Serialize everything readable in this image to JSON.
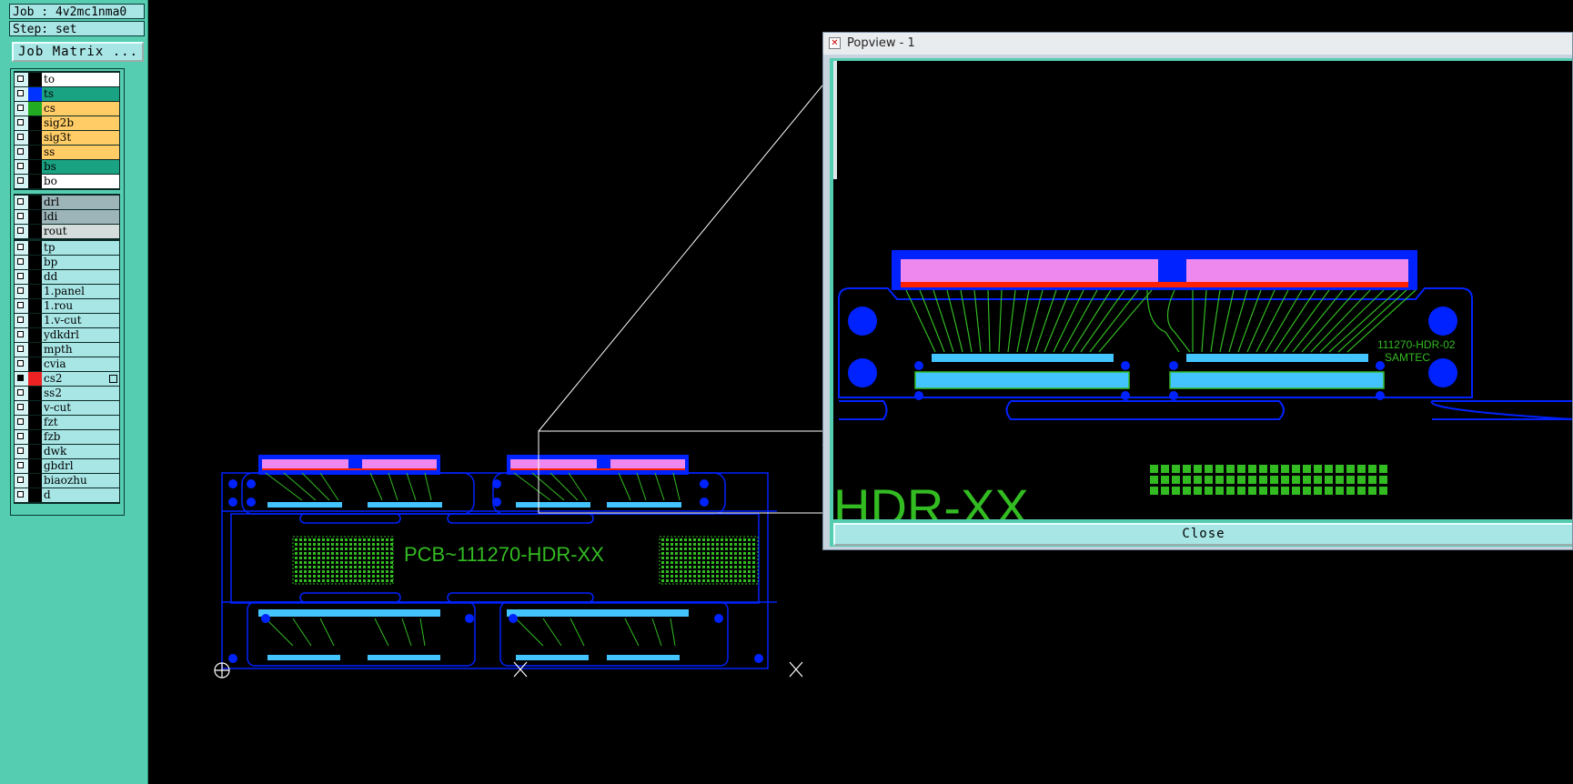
{
  "job": {
    "label": "Job : 4v2mc1nma0"
  },
  "step": {
    "label": "Step: set"
  },
  "job_matrix_button": "Job Matrix ...",
  "layers": {
    "board": [
      {
        "name": "to",
        "color": "#ffffff",
        "swatch": "#000000",
        "checked": false
      },
      {
        "name": "ts",
        "color": "#1aa382",
        "swatch": "#0033ff",
        "checked": false
      },
      {
        "name": "cs",
        "color": "#ffcc66",
        "swatch": "#22aa22",
        "checked": false
      },
      {
        "name": "sig2b",
        "color": "#ffcc66",
        "swatch": "#000000",
        "checked": false
      },
      {
        "name": "sig3t",
        "color": "#ffcc66",
        "swatch": "#000000",
        "checked": false
      },
      {
        "name": "ss",
        "color": "#ffcc66",
        "swatch": "#000000",
        "checked": false
      },
      {
        "name": "bs",
        "color": "#1aa382",
        "swatch": "#000000",
        "checked": false
      },
      {
        "name": "bo",
        "color": "#ffffff",
        "swatch": "#000000",
        "checked": false
      }
    ],
    "drill": [
      {
        "name": "drl",
        "color": "#9db4b8",
        "swatch": "#000000",
        "checked": false
      },
      {
        "name": "ldi",
        "color": "#9db4b8",
        "swatch": "#000000",
        "checked": false
      },
      {
        "name": "rout",
        "color": "#d4dcdc",
        "swatch": "#000000",
        "checked": false
      }
    ],
    "misc": [
      {
        "name": "tp",
        "color": "#a8e6e6",
        "swatch": "#000000",
        "checked": false
      },
      {
        "name": "bp",
        "color": "#a8e6e6",
        "swatch": "#000000",
        "checked": false
      },
      {
        "name": "dd",
        "color": "#a8e6e6",
        "swatch": "#000000",
        "checked": false
      },
      {
        "name": "1.panel",
        "color": "#a8e6e6",
        "swatch": "#000000",
        "checked": false
      },
      {
        "name": "1.rou",
        "color": "#a8e6e6",
        "swatch": "#000000",
        "checked": false
      },
      {
        "name": "1.v-cut",
        "color": "#a8e6e6",
        "swatch": "#000000",
        "checked": false
      },
      {
        "name": "ydkdrl",
        "color": "#a8e6e6",
        "swatch": "#000000",
        "checked": false
      },
      {
        "name": "mpth",
        "color": "#a8e6e6",
        "swatch": "#000000",
        "checked": false
      },
      {
        "name": "cvia",
        "color": "#a8e6e6",
        "swatch": "#000000",
        "checked": false
      },
      {
        "name": "cs2",
        "color": "#a8e6e6",
        "swatch": "#ee2222",
        "checked": true,
        "badge": true
      },
      {
        "name": "ss2",
        "color": "#a8e6e6",
        "swatch": "#000000",
        "checked": false
      },
      {
        "name": "v-cut",
        "color": "#a8e6e6",
        "swatch": "#000000",
        "checked": false
      },
      {
        "name": "fzt",
        "color": "#a8e6e6",
        "swatch": "#000000",
        "checked": false
      },
      {
        "name": "fzb",
        "color": "#a8e6e6",
        "swatch": "#000000",
        "checked": false
      },
      {
        "name": "dwk",
        "color": "#a8e6e6",
        "swatch": "#000000",
        "checked": false
      },
      {
        "name": "gbdrl",
        "color": "#a8e6e6",
        "swatch": "#000000",
        "checked": false
      },
      {
        "name": "biaozhu",
        "color": "#a8e6e6",
        "swatch": "#000000",
        "checked": false
      },
      {
        "name": "d",
        "color": "#a8e6e6",
        "swatch": "#000000",
        "checked": false
      }
    ]
  },
  "board": {
    "panel_text": "PCB~111270-HDR-XX",
    "zoom_label_1": "111270-HDR-02",
    "zoom_label_2": "SAMTEC",
    "zoom_partial_text": "HDR-XX"
  },
  "popview": {
    "title": "Popview - 1",
    "close_label": "Close"
  },
  "colors": {
    "outline": "#0022ff",
    "trace": "#33bb22",
    "pad": "#44c4ff",
    "finger": "#ee88ee",
    "red": "#ff2200",
    "sidebar": "#55cdb0"
  }
}
